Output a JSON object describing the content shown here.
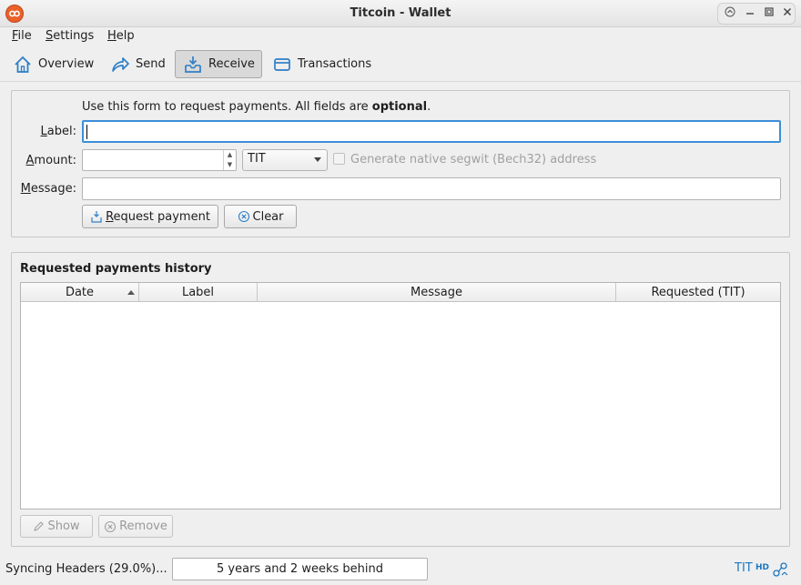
{
  "window": {
    "title": "Titcoin - Wallet",
    "controls": [
      "up-arrow-icon",
      "minimize-icon",
      "maximize-icon",
      "close-icon"
    ]
  },
  "menu": {
    "items": [
      {
        "label": "File",
        "mnemonic": "F",
        "rest": "ile"
      },
      {
        "label": "Settings",
        "mnemonic": "S",
        "rest": "ettings"
      },
      {
        "label": "Help",
        "mnemonic": "H",
        "rest": "elp"
      }
    ]
  },
  "toolbar": {
    "tabs": [
      {
        "label": "Overview",
        "icon": "home-icon",
        "active": false
      },
      {
        "label": "Send",
        "icon": "send-arrow-icon",
        "active": false
      },
      {
        "label": "Receive",
        "icon": "receive-inbox-icon",
        "active": true
      },
      {
        "label": "Transactions",
        "icon": "transactions-card-icon",
        "active": false
      }
    ]
  },
  "form": {
    "info_prefix": "Use this form to request payments. All fields are ",
    "info_bold": "optional",
    "info_suffix": ".",
    "label_label": {
      "mnemonic": "L",
      "rest": "abel:"
    },
    "amount_label": {
      "mnemonic": "A",
      "rest": "mount:"
    },
    "message_label": {
      "mnemonic": "M",
      "rest": "essage:"
    },
    "label_value": "",
    "amount_value": "",
    "message_value": "",
    "unit_selected": "TIT",
    "segwit_checkbox_label": "Generate native segwit (Bech32) address",
    "segwit_checked": false,
    "request_button": {
      "mnemonic": "R",
      "rest": "equest payment"
    },
    "clear_button": "Clear"
  },
  "history": {
    "title": "Requested payments history",
    "columns": [
      "Date",
      "Label",
      "Message",
      "Requested (TIT)"
    ],
    "sort_column": "Date",
    "sort_direction": "ascending",
    "rows": [],
    "show_button": "Show",
    "remove_button": "Remove"
  },
  "status": {
    "sync_text": "Syncing Headers (29.0%)...",
    "behind_text": "5 years and 2 weeks behind",
    "unit": "TIT",
    "hd_badge": "HD"
  },
  "colors": {
    "accent_blue": "#1a78c2",
    "app_icon_orange": "#e8612a",
    "focus_border": "#3c8ed8"
  }
}
